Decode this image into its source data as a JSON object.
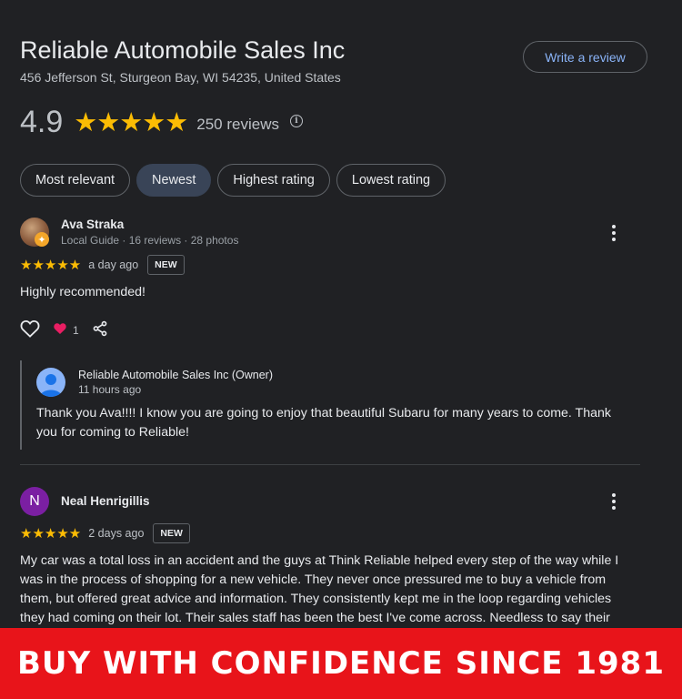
{
  "business": {
    "name": "Reliable Automobile Sales Inc",
    "address": "456 Jefferson St, Sturgeon Bay, WI 54235, United States",
    "write_review_label": "Write a review",
    "rating": "4.9",
    "stars": "★★★★★",
    "review_count": "250 reviews",
    "info_glyph": "i"
  },
  "sort_chips": [
    {
      "label": "Most relevant",
      "selected": false
    },
    {
      "label": "Newest",
      "selected": true
    },
    {
      "label": "Highest rating",
      "selected": false
    },
    {
      "label": "Lowest rating",
      "selected": false
    }
  ],
  "reviews": [
    {
      "author": "Ava Straka",
      "meta": "Local Guide · 16 reviews · 28 photos",
      "stars": "★★★★★",
      "time": "a day ago",
      "badge": "NEW",
      "text": "Highly recommended!",
      "likes": "1",
      "owner_reply": {
        "name": "Reliable Automobile Sales Inc (Owner)",
        "time": "11 hours ago",
        "text": "Thank you Ava!!!! I know you are going to enjoy that beautiful Subaru for many years to come. Thank you for coming to Reliable!"
      }
    },
    {
      "author": "Neal Henrigillis",
      "initial": "N",
      "stars": "★★★★★",
      "time": "2 days ago",
      "badge": "NEW",
      "text": "My car was a total loss in an accident and the guys at Think Reliable helped every step of the way while I was in the process of shopping for a new vehicle. They never once pressured me to buy a vehicle from them, but offered great advice and information. They consistently kept me in the loop regarding vehicles they had coming on their lot. Their sales staff has been the best I've come across. Needless to say their"
    }
  ],
  "banner": "BUY WITH CONFIDENCE SINCE 1981",
  "colors": {
    "background": "#202124",
    "star": "#fbbc04",
    "link": "#8ab4f8",
    "banner": "#e8141a",
    "chip_selected": "#394457",
    "avatar_n": "#7b1fa2"
  }
}
